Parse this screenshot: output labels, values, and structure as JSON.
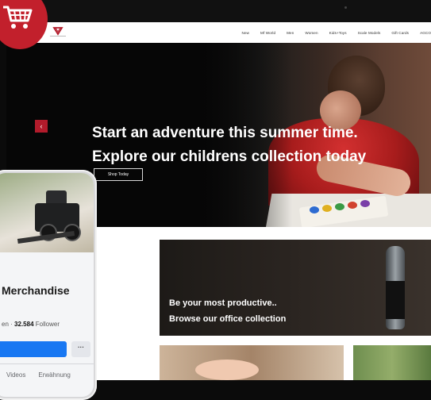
{
  "site": {
    "nav": {
      "links": [
        "New",
        "Mf World",
        "Men",
        "Women",
        "Kids+Toys",
        "Scale Models",
        "Gift Cards",
        "AGCO"
      ]
    },
    "hero": {
      "prev_icon": "chevron-left-icon",
      "line1": "Start an adventure this summer time.",
      "line2": "Explore our childrens collection today",
      "button_label": "Shop Today"
    },
    "office_banner": {
      "line1": "Be your most productive..",
      "line2": "Browse our office collection"
    }
  },
  "cart_badge": {
    "icon": "shopping-cart-icon",
    "color": "#c2202c"
  },
  "phone": {
    "page_name": "Merchandise",
    "stats": {
      "likes_suffix": "en",
      "separator": "·",
      "followers_count": "32.584",
      "followers_label": "Follower"
    },
    "more_label": "···",
    "tabs": [
      "Videos",
      "Erwähnung"
    ]
  },
  "colors": {
    "brand_red": "#b21b2b",
    "facebook_blue": "#1877f2"
  }
}
